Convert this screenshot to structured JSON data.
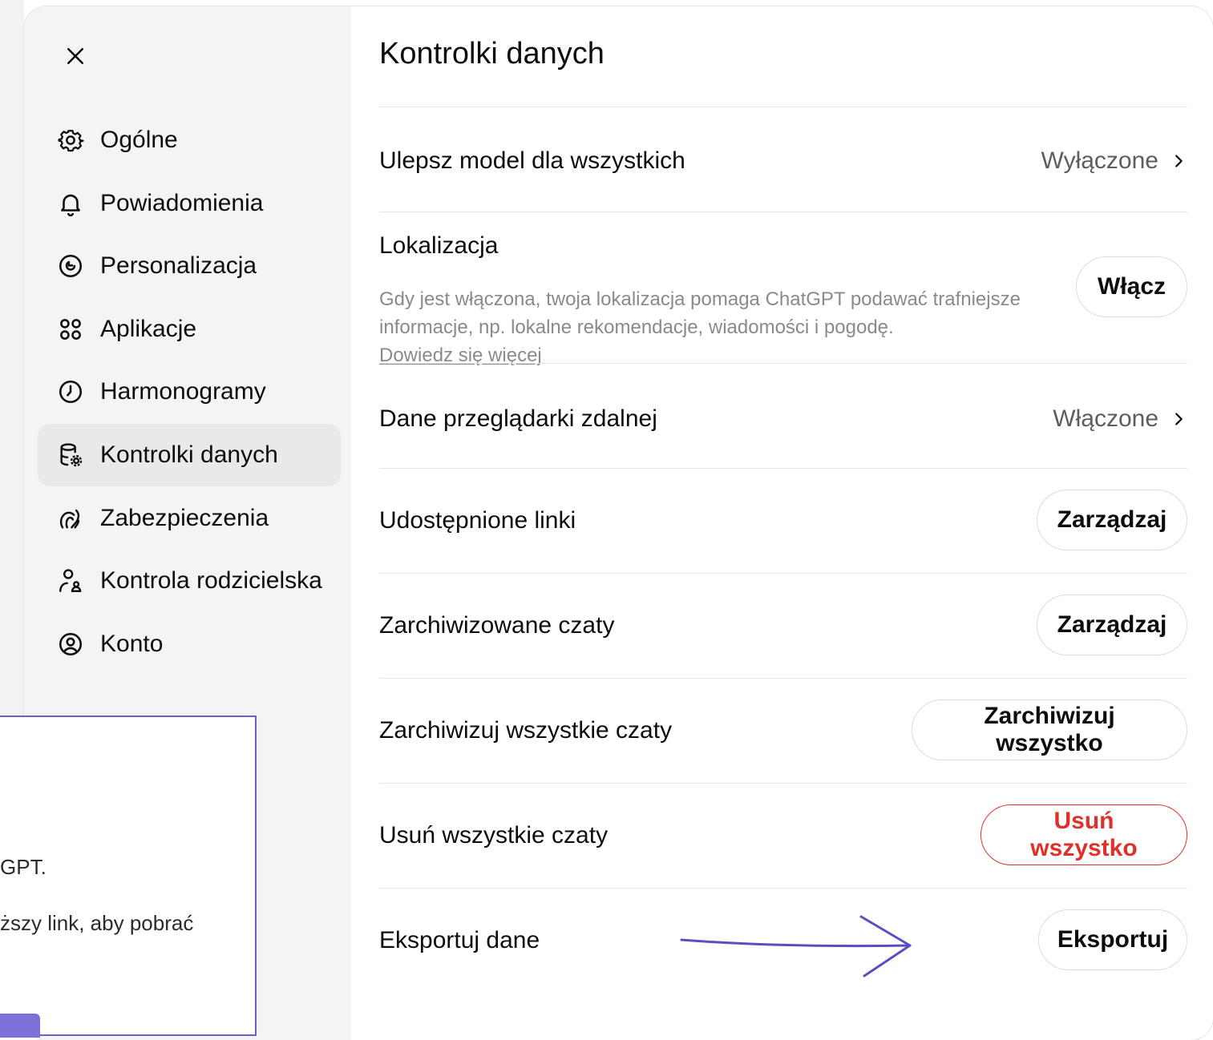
{
  "sidebar": {
    "items": [
      {
        "label": "Ogólne",
        "icon": "gear-icon"
      },
      {
        "label": "Powiadomienia",
        "icon": "bell-icon"
      },
      {
        "label": "Personalizacja",
        "icon": "personalization-icon"
      },
      {
        "label": "Aplikacje",
        "icon": "apps-grid-icon"
      },
      {
        "label": "Harmonogramy",
        "icon": "clock-icon"
      },
      {
        "label": "Kontrolki danych",
        "icon": "database-gear-icon",
        "active": true
      },
      {
        "label": "Zabezpieczenia",
        "icon": "security-icon"
      },
      {
        "label": "Kontrola rodzicielska",
        "icon": "parental-control-icon"
      },
      {
        "label": "Konto",
        "icon": "account-icon"
      }
    ]
  },
  "main": {
    "title": "Kontrolki danych",
    "rows": {
      "improve_model": {
        "label": "Ulepsz model dla wszystkich",
        "value": "Wyłączone"
      },
      "location": {
        "label": "Lokalizacja",
        "description": "Gdy jest włączona, twoja lokalizacja pomaga ChatGPT podawać trafniejsze informacje, np. lokalne rekomendacje, wiadomości i pogodę.",
        "link": "Dowiedz się więcej",
        "button": "Włącz"
      },
      "remote_browser": {
        "label": "Dane przeglądarki zdalnej",
        "value": "Włączone"
      },
      "shared_links": {
        "label": "Udostępnione linki",
        "button": "Zarządzaj"
      },
      "archived_chats": {
        "label": "Zarchiwizowane czaty",
        "button": "Zarządzaj"
      },
      "archive_all": {
        "label": "Zarchiwizuj wszystkie czaty",
        "button": "Zarchiwizuj wszystko"
      },
      "delete_all": {
        "label": "Usuń wszystkie czaty",
        "button": "Usuń wszystko"
      },
      "export": {
        "label": "Eksportuj dane",
        "button": "Eksportuj"
      }
    }
  },
  "popup": {
    "line1": "GPT.",
    "line2": "ższy link, aby pobrać"
  },
  "colors": {
    "accent": "#6b5fc9",
    "danger": "#e0302a",
    "sidebar_bg": "#f4f4f4",
    "active_bg": "#e9e9e9"
  }
}
